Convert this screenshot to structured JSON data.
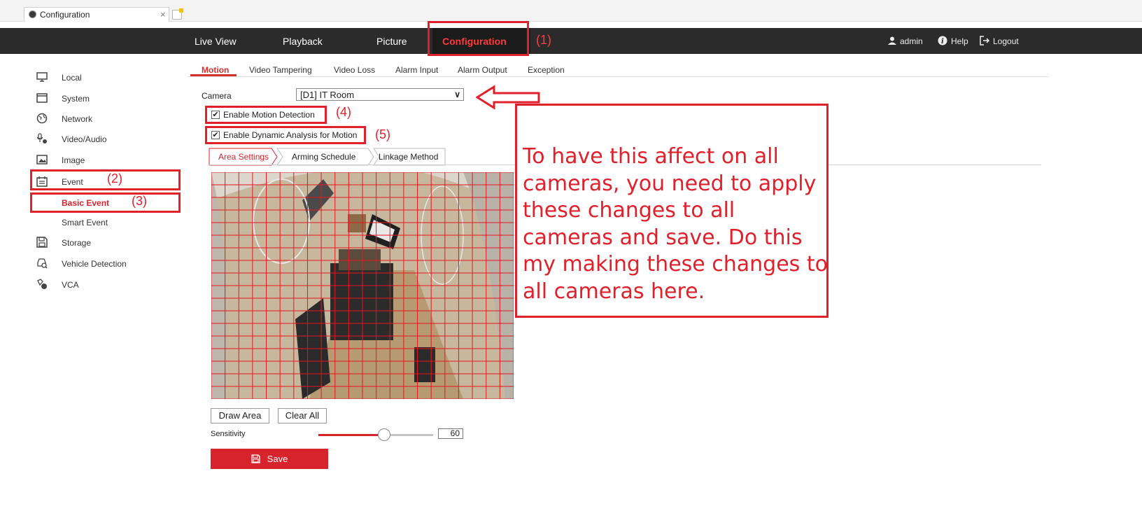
{
  "browser": {
    "tab_title": "Configuration",
    "tab_close": "×"
  },
  "topnav": {
    "live_view": "Live View",
    "playback": "Playback",
    "picture": "Picture",
    "configuration": "Configuration",
    "user": "admin",
    "help": "Help",
    "logout": "Logout"
  },
  "sidebar": {
    "items": [
      {
        "label": "Local",
        "icon": "monitor-icon"
      },
      {
        "label": "System",
        "icon": "window-icon"
      },
      {
        "label": "Network",
        "icon": "globe-icon"
      },
      {
        "label": "Video/Audio",
        "icon": "microphone-camera-icon"
      },
      {
        "label": "Image",
        "icon": "image-icon"
      },
      {
        "label": "Event",
        "icon": "calendar-icon"
      },
      {
        "label": "Storage",
        "icon": "floppy-icon"
      },
      {
        "label": "Vehicle Detection",
        "icon": "car-search-icon"
      },
      {
        "label": "VCA",
        "icon": "vca-icon"
      }
    ],
    "sub_items": [
      "Basic Event",
      "Smart Event"
    ]
  },
  "subtabs": [
    "Motion",
    "Video Tampering",
    "Video Loss",
    "Alarm Input",
    "Alarm Output",
    "Exception"
  ],
  "form": {
    "camera_label": "Camera",
    "camera_value": "[D1] IT Room",
    "enable_motion": "Enable Motion Detection",
    "enable_dynamic": "Enable Dynamic Analysis for Motion",
    "area_tabs": [
      "Area Settings",
      "Arming Schedule",
      "Linkage Method"
    ],
    "draw_area": "Draw Area",
    "clear_all": "Clear All",
    "sensitivity_label": "Sensitivity",
    "sensitivity_value": "60",
    "save": "Save"
  },
  "annotations": {
    "a1": "(1)",
    "a2": "(2)",
    "a3": "(3)",
    "a4": "(4)",
    "a5": "(5)",
    "note": "To have this affect on all cameras, you need to apply these changes to all cameras and save. Do this my making these changes to all cameras here."
  },
  "colors": {
    "accent": "#d7232c",
    "annotation": "#e0202a",
    "nav_bg": "#2b2b2b"
  }
}
